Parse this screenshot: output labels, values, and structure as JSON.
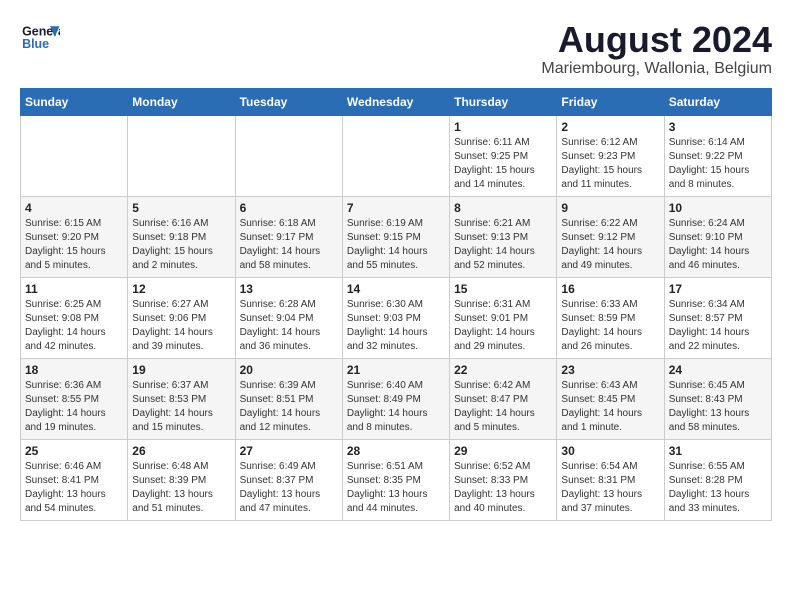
{
  "header": {
    "logo_line1": "General",
    "logo_line2": "Blue",
    "title": "August 2024",
    "subtitle": "Mariembourg, Wallonia, Belgium"
  },
  "days_of_week": [
    "Sunday",
    "Monday",
    "Tuesday",
    "Wednesday",
    "Thursday",
    "Friday",
    "Saturday"
  ],
  "weeks": [
    [
      {
        "day": "",
        "info": ""
      },
      {
        "day": "",
        "info": ""
      },
      {
        "day": "",
        "info": ""
      },
      {
        "day": "",
        "info": ""
      },
      {
        "day": "1",
        "info": "Sunrise: 6:11 AM\nSunset: 9:25 PM\nDaylight: 15 hours\nand 14 minutes."
      },
      {
        "day": "2",
        "info": "Sunrise: 6:12 AM\nSunset: 9:23 PM\nDaylight: 15 hours\nand 11 minutes."
      },
      {
        "day": "3",
        "info": "Sunrise: 6:14 AM\nSunset: 9:22 PM\nDaylight: 15 hours\nand 8 minutes."
      }
    ],
    [
      {
        "day": "4",
        "info": "Sunrise: 6:15 AM\nSunset: 9:20 PM\nDaylight: 15 hours\nand 5 minutes."
      },
      {
        "day": "5",
        "info": "Sunrise: 6:16 AM\nSunset: 9:18 PM\nDaylight: 15 hours\nand 2 minutes."
      },
      {
        "day": "6",
        "info": "Sunrise: 6:18 AM\nSunset: 9:17 PM\nDaylight: 14 hours\nand 58 minutes."
      },
      {
        "day": "7",
        "info": "Sunrise: 6:19 AM\nSunset: 9:15 PM\nDaylight: 14 hours\nand 55 minutes."
      },
      {
        "day": "8",
        "info": "Sunrise: 6:21 AM\nSunset: 9:13 PM\nDaylight: 14 hours\nand 52 minutes."
      },
      {
        "day": "9",
        "info": "Sunrise: 6:22 AM\nSunset: 9:12 PM\nDaylight: 14 hours\nand 49 minutes."
      },
      {
        "day": "10",
        "info": "Sunrise: 6:24 AM\nSunset: 9:10 PM\nDaylight: 14 hours\nand 46 minutes."
      }
    ],
    [
      {
        "day": "11",
        "info": "Sunrise: 6:25 AM\nSunset: 9:08 PM\nDaylight: 14 hours\nand 42 minutes."
      },
      {
        "day": "12",
        "info": "Sunrise: 6:27 AM\nSunset: 9:06 PM\nDaylight: 14 hours\nand 39 minutes."
      },
      {
        "day": "13",
        "info": "Sunrise: 6:28 AM\nSunset: 9:04 PM\nDaylight: 14 hours\nand 36 minutes."
      },
      {
        "day": "14",
        "info": "Sunrise: 6:30 AM\nSunset: 9:03 PM\nDaylight: 14 hours\nand 32 minutes."
      },
      {
        "day": "15",
        "info": "Sunrise: 6:31 AM\nSunset: 9:01 PM\nDaylight: 14 hours\nand 29 minutes."
      },
      {
        "day": "16",
        "info": "Sunrise: 6:33 AM\nSunset: 8:59 PM\nDaylight: 14 hours\nand 26 minutes."
      },
      {
        "day": "17",
        "info": "Sunrise: 6:34 AM\nSunset: 8:57 PM\nDaylight: 14 hours\nand 22 minutes."
      }
    ],
    [
      {
        "day": "18",
        "info": "Sunrise: 6:36 AM\nSunset: 8:55 PM\nDaylight: 14 hours\nand 19 minutes."
      },
      {
        "day": "19",
        "info": "Sunrise: 6:37 AM\nSunset: 8:53 PM\nDaylight: 14 hours\nand 15 minutes."
      },
      {
        "day": "20",
        "info": "Sunrise: 6:39 AM\nSunset: 8:51 PM\nDaylight: 14 hours\nand 12 minutes."
      },
      {
        "day": "21",
        "info": "Sunrise: 6:40 AM\nSunset: 8:49 PM\nDaylight: 14 hours\nand 8 minutes."
      },
      {
        "day": "22",
        "info": "Sunrise: 6:42 AM\nSunset: 8:47 PM\nDaylight: 14 hours\nand 5 minutes."
      },
      {
        "day": "23",
        "info": "Sunrise: 6:43 AM\nSunset: 8:45 PM\nDaylight: 14 hours\nand 1 minute."
      },
      {
        "day": "24",
        "info": "Sunrise: 6:45 AM\nSunset: 8:43 PM\nDaylight: 13 hours\nand 58 minutes."
      }
    ],
    [
      {
        "day": "25",
        "info": "Sunrise: 6:46 AM\nSunset: 8:41 PM\nDaylight: 13 hours\nand 54 minutes."
      },
      {
        "day": "26",
        "info": "Sunrise: 6:48 AM\nSunset: 8:39 PM\nDaylight: 13 hours\nand 51 minutes."
      },
      {
        "day": "27",
        "info": "Sunrise: 6:49 AM\nSunset: 8:37 PM\nDaylight: 13 hours\nand 47 minutes."
      },
      {
        "day": "28",
        "info": "Sunrise: 6:51 AM\nSunset: 8:35 PM\nDaylight: 13 hours\nand 44 minutes."
      },
      {
        "day": "29",
        "info": "Sunrise: 6:52 AM\nSunset: 8:33 PM\nDaylight: 13 hours\nand 40 minutes."
      },
      {
        "day": "30",
        "info": "Sunrise: 6:54 AM\nSunset: 8:31 PM\nDaylight: 13 hours\nand 37 minutes."
      },
      {
        "day": "31",
        "info": "Sunrise: 6:55 AM\nSunset: 8:28 PM\nDaylight: 13 hours\nand 33 minutes."
      }
    ]
  ]
}
